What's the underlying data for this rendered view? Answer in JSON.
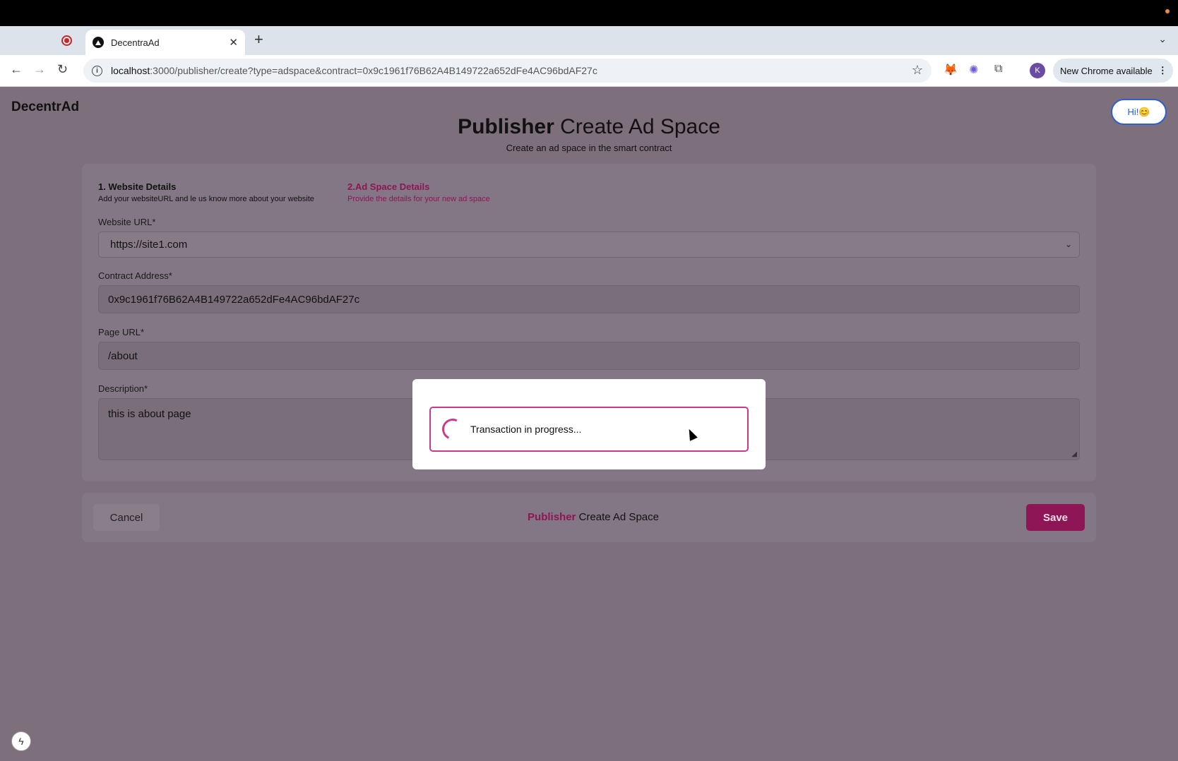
{
  "browser": {
    "tab_title": "DecentraAd",
    "new_tab_label": "+",
    "url_host": "localhost",
    "url_rest": ":3000/publisher/create?type=adspace&contract=0x9c1961f76B62A4B149722a652dFe4AC96bdAF27c",
    "profile_initial": "K",
    "update_label": "New Chrome available"
  },
  "header": {
    "logo": "DecentrAd",
    "hi_button": "Hi!😊"
  },
  "page": {
    "title_bold": "Publisher",
    "title_rest": " Create Ad Space",
    "subtitle": "Create an ad space in the smart contract"
  },
  "steps": [
    {
      "title": "1. Website Details",
      "subtitle": "Add your websiteURL and le us know more about your website"
    },
    {
      "title": "2.Ad Space Details",
      "subtitle": "Provide the details for your new ad space"
    }
  ],
  "form": {
    "website_url_label": "Website URL*",
    "website_url_value": "https://site1.com",
    "contract_label": "Contract Address*",
    "contract_value": "0x9c1961f76B62A4B149722a652dFe4AC96bdAF27c",
    "page_url_label": "Page URL*",
    "page_url_value": "/about",
    "description_label": "Description*",
    "description_value": "this is about page"
  },
  "footer": {
    "cancel_label": "Cancel",
    "title_bold": "Publisher",
    "title_rest": " Create Ad Space",
    "save_label": "Save"
  },
  "modal": {
    "progress_text": "Transaction in progress..."
  },
  "colors": {
    "accent": "#8e1656",
    "spinner": "#c93b8a",
    "overlay_bg": "#7d6f7c"
  }
}
